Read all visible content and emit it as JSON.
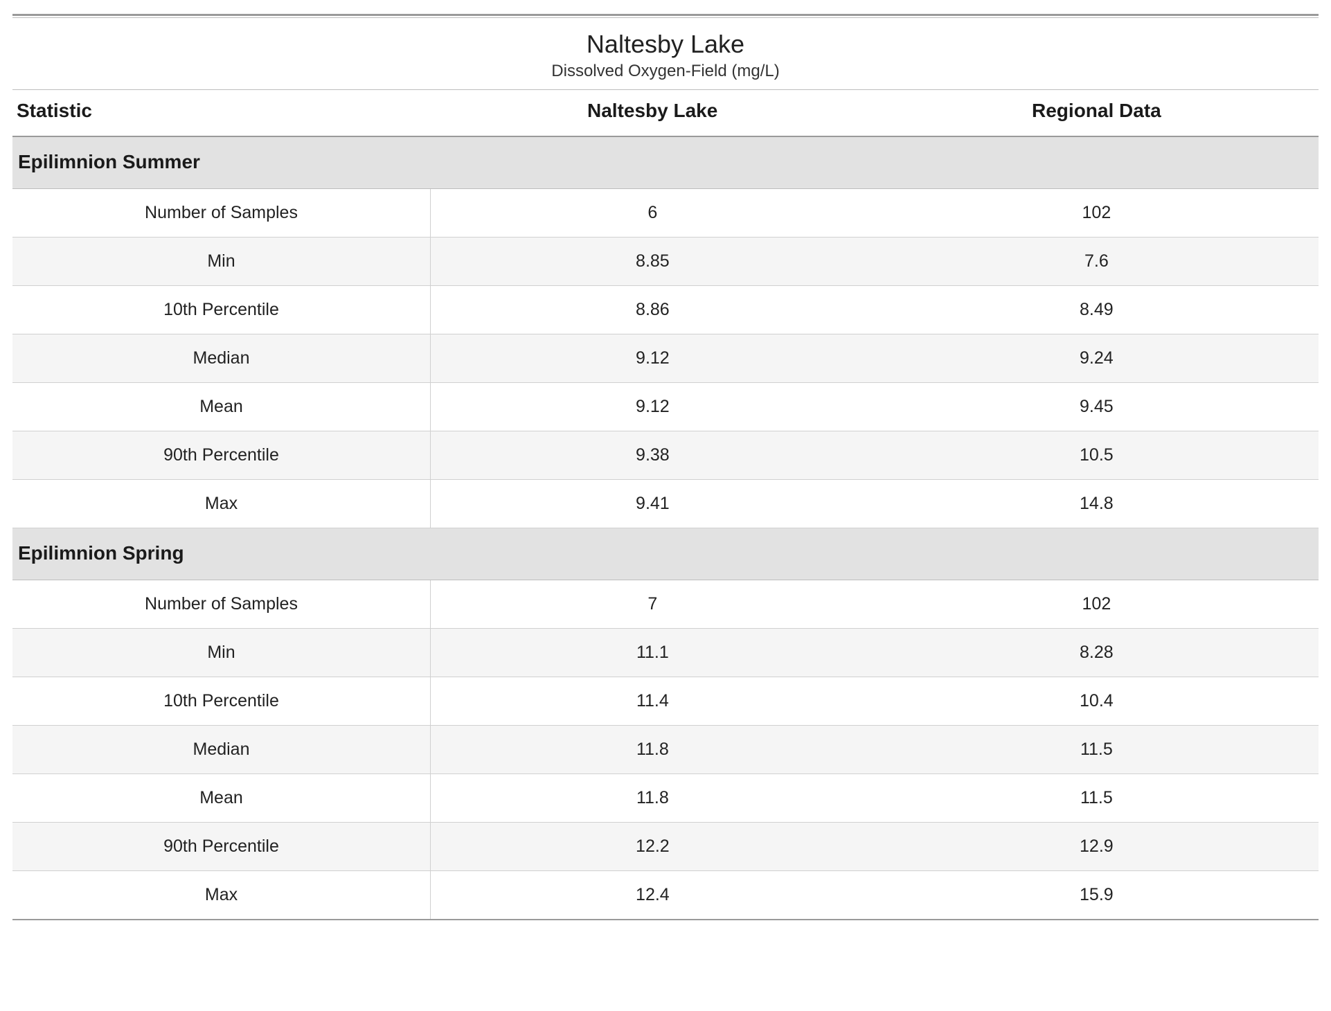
{
  "title": "Naltesby Lake",
  "subtitle": "Dissolved Oxygen-Field (mg/L)",
  "columns": {
    "stat": "Statistic",
    "site": "Naltesby Lake",
    "regional": "Regional Data"
  },
  "sections": [
    {
      "name": "Epilimnion Summer",
      "rows": [
        {
          "stat": "Number of Samples",
          "site": "6",
          "regional": "102"
        },
        {
          "stat": "Min",
          "site": "8.85",
          "regional": "7.6"
        },
        {
          "stat": "10th Percentile",
          "site": "8.86",
          "regional": "8.49"
        },
        {
          "stat": "Median",
          "site": "9.12",
          "regional": "9.24"
        },
        {
          "stat": "Mean",
          "site": "9.12",
          "regional": "9.45"
        },
        {
          "stat": "90th Percentile",
          "site": "9.38",
          "regional": "10.5"
        },
        {
          "stat": "Max",
          "site": "9.41",
          "regional": "14.8"
        }
      ]
    },
    {
      "name": "Epilimnion Spring",
      "rows": [
        {
          "stat": "Number of Samples",
          "site": "7",
          "regional": "102"
        },
        {
          "stat": "Min",
          "site": "11.1",
          "regional": "8.28"
        },
        {
          "stat": "10th Percentile",
          "site": "11.4",
          "regional": "10.4"
        },
        {
          "stat": "Median",
          "site": "11.8",
          "regional": "11.5"
        },
        {
          "stat": "Mean",
          "site": "11.8",
          "regional": "11.5"
        },
        {
          "stat": "90th Percentile",
          "site": "12.2",
          "regional": "12.9"
        },
        {
          "stat": "Max",
          "site": "12.4",
          "regional": "15.9"
        }
      ]
    }
  ],
  "chart_data": {
    "type": "table",
    "title": "Naltesby Lake — Dissolved Oxygen-Field (mg/L)",
    "groups": [
      "Epilimnion Summer",
      "Epilimnion Spring"
    ],
    "statistics": [
      "Number of Samples",
      "Min",
      "10th Percentile",
      "Median",
      "Mean",
      "90th Percentile",
      "Max"
    ],
    "series": [
      {
        "name": "Naltesby Lake",
        "Epilimnion Summer": [
          6,
          8.85,
          8.86,
          9.12,
          9.12,
          9.38,
          9.41
        ],
        "Epilimnion Spring": [
          7,
          11.1,
          11.4,
          11.8,
          11.8,
          12.2,
          12.4
        ]
      },
      {
        "name": "Regional Data",
        "Epilimnion Summer": [
          102,
          7.6,
          8.49,
          9.24,
          9.45,
          10.5,
          14.8
        ],
        "Epilimnion Spring": [
          102,
          8.28,
          10.4,
          11.5,
          11.5,
          12.9,
          15.9
        ]
      }
    ]
  }
}
